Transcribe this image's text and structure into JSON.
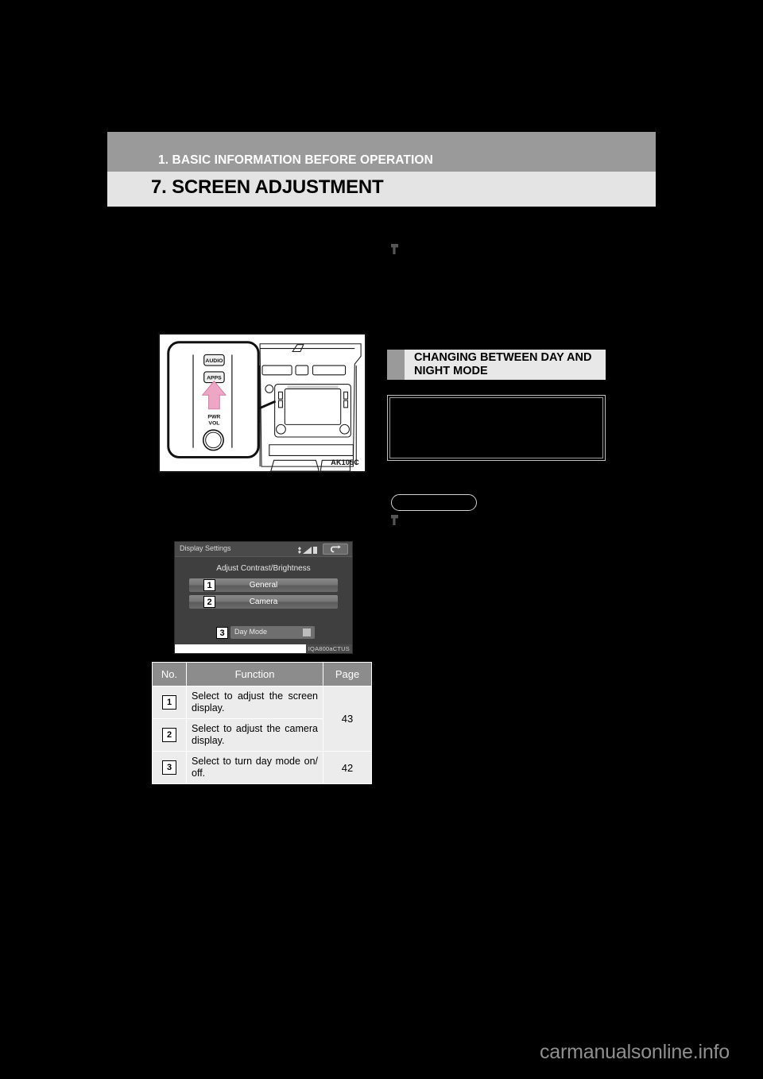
{
  "header": {
    "chapter": "1. BASIC INFORMATION BEFORE OPERATION",
    "title": "7. SCREEN ADJUSTMENT"
  },
  "left_column": {
    "intro_paragraph": "",
    "marker_note": ""
  },
  "dashboard_figure": {
    "alt": "Instrument panel audio control buttons",
    "buttons": {
      "audio": "AUDIO",
      "apps": "APPS",
      "power_line1": "PWR",
      "power_line2": "VOL"
    },
    "figure_code": "AK105C",
    "arrow_color": "#eda7c4"
  },
  "nav_screen_figure": {
    "title": "Display Settings",
    "heading": "Adjust Contrast/Brightness",
    "buttons": [
      {
        "number": "1",
        "label": "General"
      },
      {
        "number": "2",
        "label": "Camera"
      }
    ],
    "day_mode": {
      "number": "3",
      "label": "Day Mode",
      "checked": false
    },
    "status_icons": [
      "bluetooth-icon",
      "signal-icon",
      "battery-icon",
      "back-arrow-icon"
    ],
    "figure_code": "IQA800aCTUS"
  },
  "function_table": {
    "columns": [
      "No.",
      "Function",
      "Page"
    ],
    "rows": [
      {
        "no": "1",
        "function": "Select to adjust the screen display.",
        "page": "43",
        "page_rowspan": 2
      },
      {
        "no": "2",
        "function": "Select to adjust the camera display.",
        "page": "",
        "page_rowspan": 0
      },
      {
        "no": "3",
        "function": "Select to turn day mode on/ off.",
        "page": "42",
        "page_rowspan": 1
      }
    ]
  },
  "right_column": {
    "section_heading": "CHANGING BETWEEN DAY AND NIGHT MODE",
    "notice_text": "",
    "button_graphic_label": "",
    "marker_note": ""
  },
  "watermark": "carmanualsonline.info",
  "colors": {
    "page_background": "#000000",
    "chapter_bar": "#9a9a9a",
    "title_bar": "#e4e4e4",
    "table_header": "#8c8c8c",
    "table_cell": "#ececec",
    "accent_pink": "#eda7c4",
    "watermark": "#8f8f8f"
  }
}
